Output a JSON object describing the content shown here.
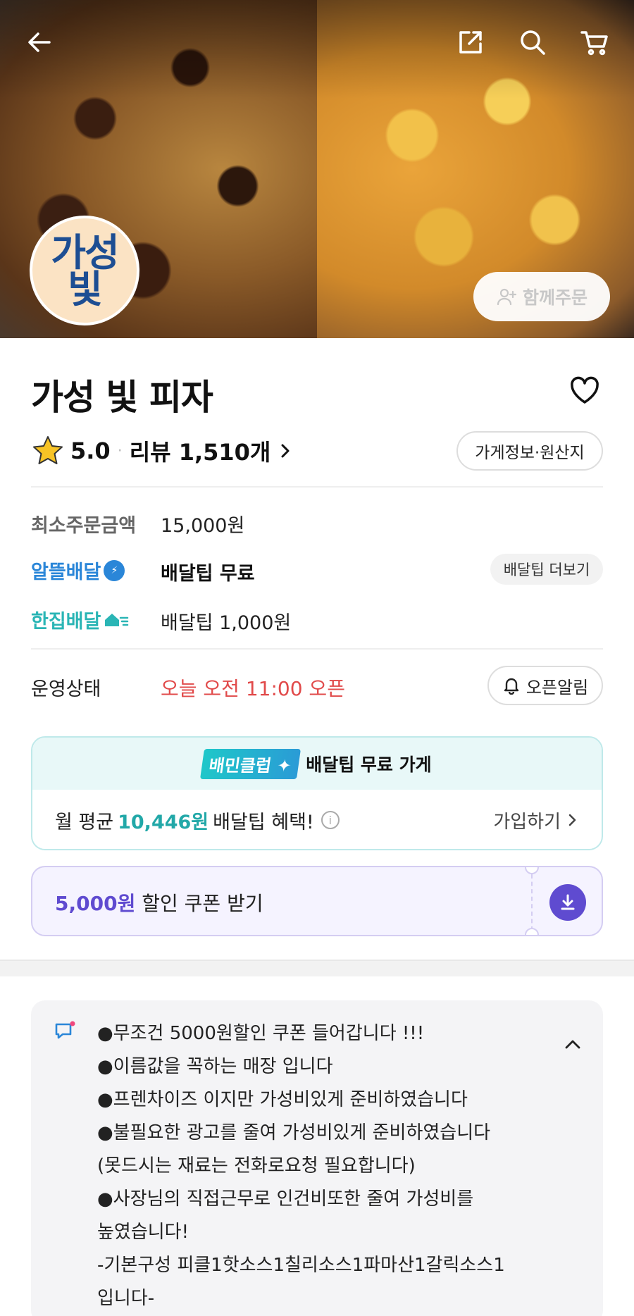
{
  "header": {
    "icons": [
      "back-arrow-icon",
      "share-icon",
      "search-icon",
      "cart-icon"
    ],
    "logo_text": [
      "가성",
      "빛"
    ],
    "together_order_label": "함께주문"
  },
  "store": {
    "name": "가성 빛 피자",
    "rating": "5.0",
    "review_label": "리뷰 1,510개",
    "info_button": "가게정보·원산지"
  },
  "details": {
    "min_order_label": "최소주문금액",
    "min_order_value": "15,000원",
    "altteul_label": "알뜰배달",
    "altteul_value": "배달팁 무료",
    "more_tip_label": "배달팁 더보기",
    "hanjip_label": "한집배달",
    "hanjip_value": "배달팁 1,000원",
    "status_label": "운영상태",
    "status_value": "오늘 오전 11:00 오픈",
    "alarm_label": "오픈알림"
  },
  "club": {
    "logo": "배민클럽",
    "title": "배달팁 무료 가게",
    "benefit_prefix": "월 평균",
    "benefit_amount": "10,446원",
    "benefit_suffix": "배달팁 혜택!",
    "join_label": "가입하기"
  },
  "coupon": {
    "amount": "5,000원",
    "label": "할인 쿠폰 받기"
  },
  "notice": {
    "lines": [
      "●무조건 5000원할인 쿠폰 들어갑니다 !!!",
      "●이름값을 꼭하는 매장 입니다",
      "●프렌차이즈 이지만 가성비있게 준비하였습니다",
      "●불필요한 광고를 줄여 가성비있게 준비하였습니다",
      "(못드시는 재료는 전화로요청 필요합니다)",
      "●사장님의 직접근무로 인건비또한 줄여 가성비를",
      "높였습니다!",
      "-기본구성 피클1핫소스1칠리소스1파마산1갈릭소스1",
      "입니다-"
    ]
  },
  "colors": {
    "altteul_blue": "#2a86d8",
    "hanjip_teal": "#2ab5b5",
    "status_red": "#e14a4a",
    "club_teal": "#22a8a8",
    "coupon_purple": "#5f4bd0"
  }
}
